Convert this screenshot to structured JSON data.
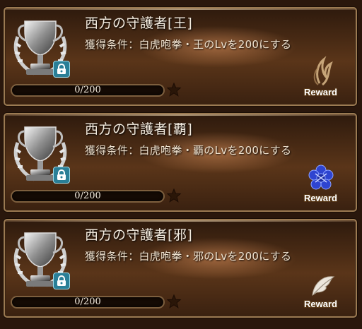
{
  "reward_label": "Reward",
  "cards": [
    {
      "title": "西方の守護者[王]",
      "condition": "獲得条件：白虎咆拳・王のLvを200にする",
      "progress": "0/200",
      "progress_fraction": 0,
      "locked": true,
      "reward_icon": "golden-swirl-icon"
    },
    {
      "title": "西方の守護者[覇]",
      "condition": "獲得条件：白虎咆拳・覇のLvを200にする",
      "progress": "0/200",
      "progress_fraction": 0,
      "locked": true,
      "reward_icon": "blue-flower-emblem-icon"
    },
    {
      "title": "西方の守護者[邪]",
      "condition": "獲得条件：白虎咆拳・邪のLvを200にする",
      "progress": "0/200",
      "progress_fraction": 0,
      "locked": true,
      "reward_icon": "white-feather-icon"
    }
  ],
  "colors": {
    "lock_badge": "#2a7f97",
    "flower_reward": "#3048d8",
    "frame": "#9b7a52"
  }
}
